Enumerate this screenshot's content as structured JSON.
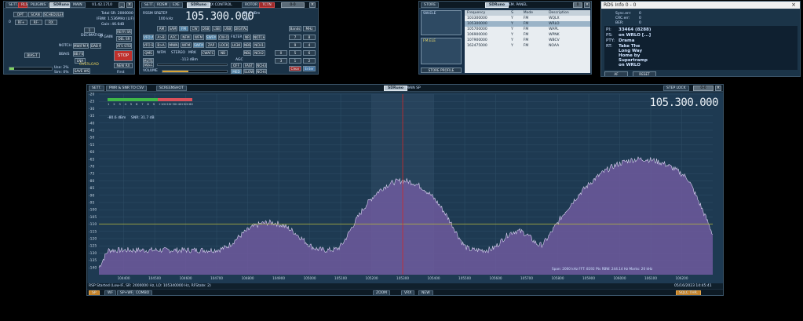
{
  "radio_panel": {
    "buttons": [
      "SETT.",
      "RLS",
      "PLUGINS",
      "MAIN"
    ],
    "logo": "SDRuno",
    "version": "V1.42.1710",
    "row1": [
      "OPT",
      "SCAN",
      "SCHEDULER"
    ],
    "row2": [
      "RF+",
      "RF-",
      "RX"
    ],
    "total_sr": "Total SR: 2000000",
    "ifbw": "IFBW: 1.536MHz (LIF)",
    "gain": "Gain: 46.6dB",
    "decimation_label": "DECIMATION",
    "decimation_value": "1",
    "side_btns": [
      "REFR SR",
      "DEL SR",
      "ATS STEP",
      "IF GAIN"
    ],
    "stop": "STOP",
    "notch": "NOTCH",
    "bias": "BIAS-T",
    "new_rx": "NEW RX",
    "first": "First",
    "save_ws": "SAVE WS",
    "overload": "OVERLOAD",
    "mid_btns": [
      "BBAIS",
      "LNA",
      "BB FILT",
      "GLB",
      "RF FLT",
      "NB LIMITER",
      "MW/FM NOTCH",
      "DAB NOTCH"
    ],
    "usage": [
      "Use: 2%",
      "Sim: 0%"
    ],
    "channel_label": "0"
  },
  "rx_control": {
    "buttons": [
      "SETT.",
      "RDSM",
      "EXE",
      "RX CONTROL",
      "ROTOR",
      "TCTN"
    ],
    "logo": "SDRuno",
    "frequency": "105.300.000",
    "signal_dbm": "-80.6 dBm",
    "snr": "SNR",
    "rx_sr": "RSSM SR=",
    "step": "STEP",
    "step_value": "100 kHz",
    "mode_row": [
      "AM",
      "SAM",
      "FM",
      "CW",
      "DSB",
      "LSB",
      "USB",
      "DIGITAL"
    ],
    "vfo_row": [
      "VFO A",
      "A>B",
      "AFC",
      "NFM",
      "WFM",
      "SWFM",
      "CW-OP",
      "FILTER",
      "NR",
      "NOTCH"
    ],
    "vfo_b_row": [
      "VFO B",
      "B>A",
      "MWN",
      "WFM",
      "SWFM",
      "ZAP",
      "LOCK",
      "LK3K",
      "NBS",
      "NCH1"
    ],
    "qms_row": [
      "QMS",
      "MUTE",
      "WFM",
      "STEREO",
      "MRK",
      "CWAFC",
      "NB",
      "NBLIM",
      "NCH2"
    ],
    "squelch": "SQLC",
    "volume": "VOLUME",
    "agc": "AGC",
    "agc_opts": [
      "OFF",
      "FAST",
      "NCH3",
      "MED",
      "SLOW",
      "NCH4"
    ],
    "level": "-113 dBm",
    "keypad": [
      "7",
      "8",
      "9",
      "4",
      "5",
      "6",
      "1",
      "2",
      "3",
      "0",
      "Clear",
      "Enter"
    ],
    "keypad_top": [
      "Bands",
      "MHz"
    ]
  },
  "memory_panel": {
    "store": "STORE",
    "logo": "SDRuno",
    "mem_label": "MEM. PANEL",
    "store_profile": "STORE PROFILE",
    "lists": [
      "SW.ELE",
      "FM.ELE"
    ],
    "columns": [
      "Frequency",
      "S",
      "Mode",
      "Description"
    ],
    "rows": [
      {
        "freq": "103300000",
        "s": "Y",
        "mode": "FM",
        "desc": "WQLX"
      },
      {
        "freq": "105300000",
        "s": "Y",
        "mode": "FM",
        "desc": "WRLO"
      },
      {
        "freq": "105700000",
        "s": "Y",
        "mode": "FM",
        "desc": "WAPL"
      },
      {
        "freq": "106900000",
        "s": "Y",
        "mode": "FM",
        "desc": "WPNK"
      },
      {
        "freq": "107900000",
        "s": "Y",
        "mode": "FM",
        "desc": "WBCV"
      },
      {
        "freq": "162475000",
        "s": "Y",
        "mode": "FM",
        "desc": "NOAA"
      }
    ]
  },
  "rds_panel": {
    "title": "RDS Info 0 - 0",
    "sync_err": "Sync.err:",
    "crc_err": "CRC.err:",
    "ber": "BER:",
    "sync_val": "0",
    "crc_val": "0",
    "ber_val": "0",
    "pi_label": "PI:",
    "pi_value": "33464 (8288)",
    "ps_label": "PS:",
    "ps_value": "on WRLO  [...]",
    "pty_label": "PTY:",
    "pty_value": "Drama",
    "rt_label": "RT:",
    "rt_lines": [
      "Take The",
      "Long Way",
      "Home by",
      "Supertramp",
      "on WRLO"
    ],
    "af": "AF",
    "reset": "RESET"
  },
  "spectrum": {
    "buttons": [
      "SETT.",
      "PWR & SNR TO CSV",
      "SCREENSHOT"
    ],
    "logo": "SDRuno",
    "main_sp": "MAIN SP",
    "step_lock": "STEP LOCK",
    "frequency": "105300000",
    "frequency_display": "105.300.000",
    "dbm": "-80.6 dBm",
    "snr": "SNR: 31.7 dB",
    "status": "RSP Started (Low-IF, SR: 2000000 Hz, LO: 105340000 Hz, RFState: 2)",
    "span_info": "Span: 2000 kHz   FFT: 8192 Pts   RBW: 244.14 Hz   Marks: 20 kHz",
    "datetime": "05/16/2023  14:45:41",
    "bottom_btns": [
      "SP",
      "WF",
      "SP+WF",
      "COMBO"
    ],
    "zoom": "ZOOM",
    "vrx": "VRX",
    "new": "NEW",
    "sqlc_thr": "SQLC THR.",
    "meter_ticks": [
      "1",
      "2",
      "3",
      "4",
      "5",
      "6",
      "7",
      "8",
      "9",
      "+10",
      "+20",
      "+30",
      "+40",
      "+50",
      "+60"
    ]
  },
  "chart_data": {
    "type": "area",
    "title": "",
    "xlabel": "",
    "ylabel": "",
    "x_ticks": [
      "104400",
      "104500",
      "104600",
      "104700",
      "104800",
      "104900",
      "105000",
      "105100",
      "105200",
      "105300",
      "105400",
      "105500",
      "105600",
      "105700",
      "105800",
      "105900",
      "106000",
      "106100",
      "106200"
    ],
    "y_ticks": [
      "-20",
      "-25",
      "-30",
      "-35",
      "-40",
      "-45",
      "-50",
      "-55",
      "-60",
      "-65",
      "-70",
      "-75",
      "-80",
      "-85",
      "-90",
      "-95",
      "-100",
      "-105",
      "-110",
      "-115",
      "-120",
      "-125",
      "-130",
      "-135",
      "-140"
    ],
    "xlim": [
      104320,
      106300
    ],
    "ylim": [
      -145,
      -20
    ],
    "squelch_level": -110,
    "peaks": [
      {
        "center_khz": 104870,
        "level_dbm": -109
      },
      {
        "center_khz": 105300,
        "level_dbm": -80
      },
      {
        "center_khz": 105670,
        "level_dbm": -115
      },
      {
        "center_khz": 106070,
        "level_dbm": -65
      }
    ],
    "noise_floor_dbm": -128,
    "colors": {
      "fill": "#6e5b9e",
      "line": "#d8d2ef",
      "bg": "#1e3a52",
      "tuned": "#d12828",
      "squelch": "#b8b83a"
    }
  }
}
